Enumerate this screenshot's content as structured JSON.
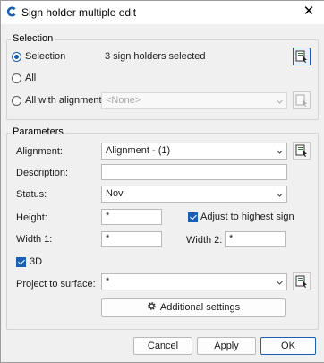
{
  "window": {
    "title": "Sign holder multiple edit",
    "close_glyph": "✕"
  },
  "selection": {
    "group_label": "Selection",
    "opt_selection": "Selection",
    "selection_info": "3 sign holders selected",
    "opt_all": "All",
    "opt_all_with_alignment": "All with alignment",
    "alignment_combo_value": "<None>",
    "selected_option": "Selection"
  },
  "parameters": {
    "group_label": "Parameters",
    "alignment_label": "Alignment:",
    "alignment_value": "Alignment - (1)",
    "description_label": "Description:",
    "description_value": "",
    "status_label": "Status:",
    "status_value": "Nov",
    "height_label": "Height:",
    "height_value": "*",
    "adjust_label": "Adjust to highest sign",
    "adjust_checked": true,
    "width1_label": "Width 1:",
    "width1_value": "*",
    "width2_label": "Width 2:",
    "width2_value": "*",
    "three_d_label": "3D",
    "three_d_checked": true,
    "project_label": "Project to surface:",
    "project_value": "*",
    "additional_settings": "Additional settings"
  },
  "footer": {
    "cancel": "Cancel",
    "apply": "Apply",
    "ok": "OK"
  },
  "colors": {
    "accent": "#1a5fb4",
    "background": "#f0f0f0"
  },
  "icons": [
    "app-icon",
    "close-icon",
    "pick-object-icon",
    "chevron-down-icon",
    "gear-icon"
  ]
}
